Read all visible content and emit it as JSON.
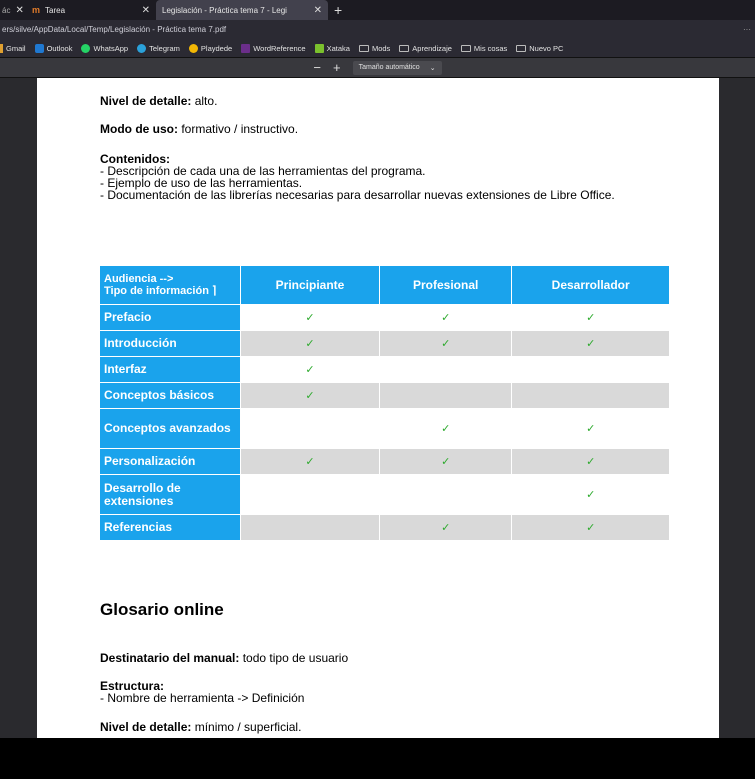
{
  "browser": {
    "tabs": [
      {
        "label": "ác"
      },
      {
        "label": "Tarea",
        "logo": "m"
      },
      {
        "label": "Legislación - Práctica tema 7 - Legi",
        "active": true
      }
    ],
    "url": "ers/silve/AppData/Local/Temp/Legislación - Práctica tema 7.pdf",
    "bookmarks": [
      "Gmail",
      "Outlook",
      "WhatsApp",
      "Telegram",
      "Playdede",
      "WordReference",
      "Xataka",
      "Mods",
      "Aprendizaje",
      "Mis cosas",
      "Nuevo PC"
    ],
    "zoom": "Tamaño automático"
  },
  "document": {
    "nivel_label": "Nivel de detalle:",
    "nivel_value": "alto.",
    "modo_label": "Modo de uso:",
    "modo_value": "formativo / instructivo.",
    "contenidos_label": "Contenidos:",
    "contenidos": [
      "-  Descripción de cada una de las herramientas del programa.",
      "-  Ejemplo de uso de las herramientas.",
      "-  Documentación de las librerías necesarias para desarrollar nuevas extensiones de Libre Office."
    ],
    "table": {
      "corner_line1": "Audiencia -->",
      "corner_line2": "Tipo de información  ⌉",
      "columns": [
        "Principiante",
        "Profesional",
        "Desarrollador"
      ],
      "rows": [
        {
          "label": "Prefacio",
          "cells": [
            "✓",
            "✓",
            "✓"
          ]
        },
        {
          "label": "Introducción",
          "cells": [
            "✓",
            "✓",
            "✓"
          ]
        },
        {
          "label": "Interfaz",
          "cells": [
            "✓",
            "",
            ""
          ]
        },
        {
          "label": "Conceptos básicos",
          "cells": [
            "✓",
            "",
            ""
          ]
        },
        {
          "label": "Conceptos avanzados",
          "cells": [
            "",
            "✓",
            "✓"
          ]
        },
        {
          "label": "Personalización",
          "cells": [
            "✓",
            "✓",
            "✓"
          ]
        },
        {
          "label": "Desarrollo de extensiones",
          "cells": [
            "",
            "",
            "✓"
          ]
        },
        {
          "label": "Referencias",
          "cells": [
            "",
            "✓",
            "✓"
          ]
        }
      ]
    },
    "glosario_title": "Glosario online",
    "destinatario_label": "Destinatario del manual:",
    "destinatario_value": "todo tipo de usuario",
    "estructura_label": "Estructura:",
    "estructura_item": "-  Nombre de herramienta -> Definición",
    "nivel2_label": "Nivel de detalle:",
    "nivel2_value": "mínimo / superficial."
  }
}
